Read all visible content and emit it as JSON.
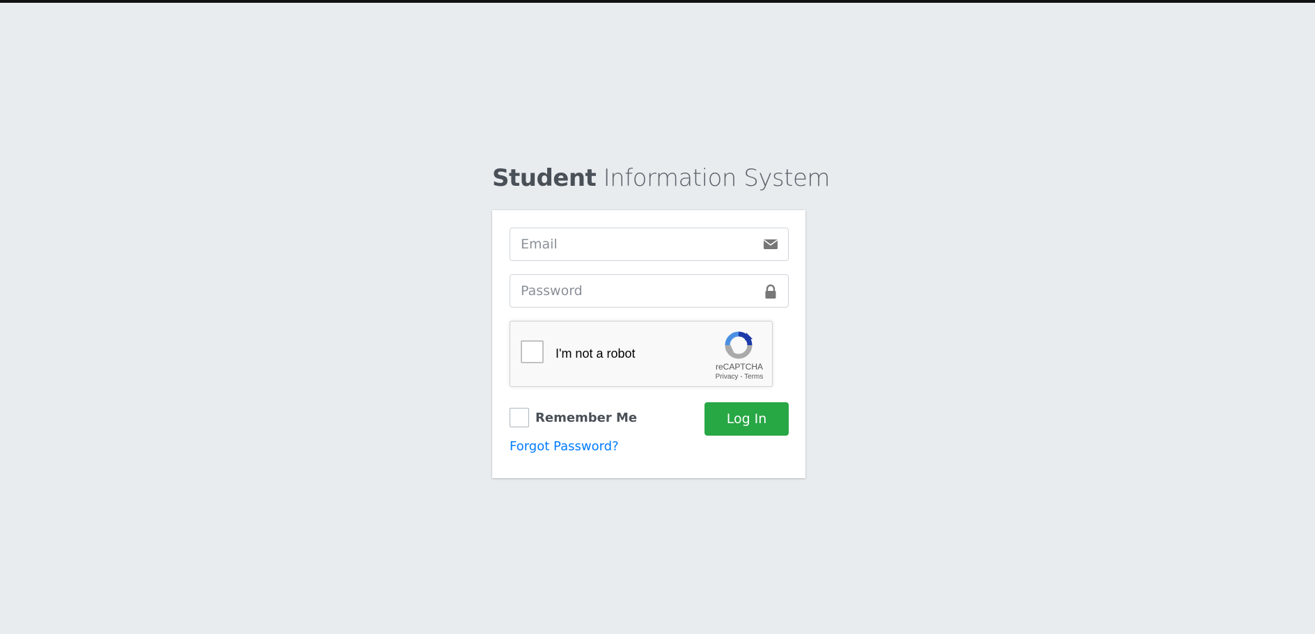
{
  "logo": {
    "bold": "Student",
    "light": " Information System"
  },
  "form": {
    "email_placeholder": "Email",
    "password_placeholder": "Password",
    "remember_label": "Remember Me",
    "login_label": "Log In",
    "forgot_label": "Forgot Password?"
  },
  "recaptcha": {
    "label": "I'm not a robot",
    "brand": "reCAPTCHA",
    "privacy": "Privacy",
    "separator": " - ",
    "terms": "Terms"
  },
  "icons": {
    "email": "envelope-icon",
    "password": "lock-icon",
    "recaptcha": "recaptcha-logo"
  },
  "colors": {
    "background": "#e9ecef",
    "primary_button": "#28a745",
    "link": "#007bff"
  }
}
